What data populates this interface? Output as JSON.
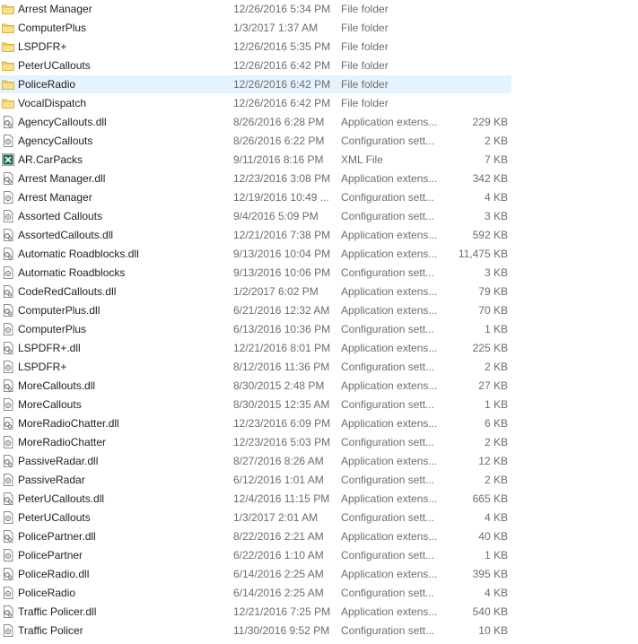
{
  "files": [
    {
      "name": "Arrest Manager",
      "date": "12/26/2016 5:34 PM",
      "type": "File folder",
      "size": "",
      "icon": "folder-icon"
    },
    {
      "name": "ComputerPlus",
      "date": "1/3/2017 1:37 AM",
      "type": "File folder",
      "size": "",
      "icon": "folder-icon"
    },
    {
      "name": "LSPDFR+",
      "date": "12/26/2016 5:35 PM",
      "type": "File folder",
      "size": "",
      "icon": "folder-icon"
    },
    {
      "name": "PeterUCallouts",
      "date": "12/26/2016 6:42 PM",
      "type": "File folder",
      "size": "",
      "icon": "folder-icon"
    },
    {
      "name": "PoliceRadio",
      "date": "12/26/2016 6:42 PM",
      "type": "File folder",
      "size": "",
      "icon": "folder-icon",
      "selected": true
    },
    {
      "name": "VocalDispatch",
      "date": "12/26/2016 6:42 PM",
      "type": "File folder",
      "size": "",
      "icon": "folder-icon"
    },
    {
      "name": "AgencyCallouts.dll",
      "date": "8/26/2016 6:28 PM",
      "type": "Application extens...",
      "size": "229 KB",
      "icon": "dll-icon"
    },
    {
      "name": "AgencyCallouts",
      "date": "8/26/2016 6:22 PM",
      "type": "Configuration sett...",
      "size": "2 KB",
      "icon": "config-icon"
    },
    {
      "name": "AR.CarPacks",
      "date": "9/11/2016 8:16 PM",
      "type": "XML File",
      "size": "7 KB",
      "icon": "xml-icon"
    },
    {
      "name": "Arrest Manager.dll",
      "date": "12/23/2016 3:08 PM",
      "type": "Application extens...",
      "size": "342 KB",
      "icon": "dll-icon"
    },
    {
      "name": "Arrest Manager",
      "date": "12/19/2016 10:49 ...",
      "type": "Configuration sett...",
      "size": "4 KB",
      "icon": "config-icon"
    },
    {
      "name": "Assorted Callouts",
      "date": "9/4/2016 5:09 PM",
      "type": "Configuration sett...",
      "size": "3 KB",
      "icon": "config-icon"
    },
    {
      "name": "AssortedCallouts.dll",
      "date": "12/21/2016 7:38 PM",
      "type": "Application extens...",
      "size": "592 KB",
      "icon": "dll-icon"
    },
    {
      "name": "Automatic Roadblocks.dll",
      "date": "9/13/2016 10:04 PM",
      "type": "Application extens...",
      "size": "11,475 KB",
      "icon": "dll-icon"
    },
    {
      "name": "Automatic Roadblocks",
      "date": "9/13/2016 10:06 PM",
      "type": "Configuration sett...",
      "size": "3 KB",
      "icon": "config-icon"
    },
    {
      "name": "CodeRedCallouts.dll",
      "date": "1/2/2017 6:02 PM",
      "type": "Application extens...",
      "size": "79 KB",
      "icon": "dll-icon"
    },
    {
      "name": "ComputerPlus.dll",
      "date": "6/21/2016 12:32 AM",
      "type": "Application extens...",
      "size": "70 KB",
      "icon": "dll-icon"
    },
    {
      "name": "ComputerPlus",
      "date": "6/13/2016 10:36 PM",
      "type": "Configuration sett...",
      "size": "1 KB",
      "icon": "config-icon"
    },
    {
      "name": "LSPDFR+.dll",
      "date": "12/21/2016 8:01 PM",
      "type": "Application extens...",
      "size": "225 KB",
      "icon": "dll-icon"
    },
    {
      "name": "LSPDFR+",
      "date": "8/12/2016 11:36 PM",
      "type": "Configuration sett...",
      "size": "2 KB",
      "icon": "config-icon"
    },
    {
      "name": "MoreCallouts.dll",
      "date": "8/30/2015 2:48 PM",
      "type": "Application extens...",
      "size": "27 KB",
      "icon": "dll-icon"
    },
    {
      "name": "MoreCallouts",
      "date": "8/30/2015 12:35 AM",
      "type": "Configuration sett...",
      "size": "1 KB",
      "icon": "config-icon"
    },
    {
      "name": "MoreRadioChatter.dll",
      "date": "12/23/2016 6:09 PM",
      "type": "Application extens...",
      "size": "6 KB",
      "icon": "dll-icon"
    },
    {
      "name": "MoreRadioChatter",
      "date": "12/23/2016 5:03 PM",
      "type": "Configuration sett...",
      "size": "2 KB",
      "icon": "config-icon"
    },
    {
      "name": "PassiveRadar.dll",
      "date": "8/27/2016 8:26 AM",
      "type": "Application extens...",
      "size": "12 KB",
      "icon": "dll-icon"
    },
    {
      "name": "PassiveRadar",
      "date": "6/12/2016 1:01 AM",
      "type": "Configuration sett...",
      "size": "2 KB",
      "icon": "config-icon"
    },
    {
      "name": "PeterUCallouts.dll",
      "date": "12/4/2016 11:15 PM",
      "type": "Application extens...",
      "size": "665 KB",
      "icon": "dll-icon"
    },
    {
      "name": "PeterUCallouts",
      "date": "1/3/2017 2:01 AM",
      "type": "Configuration sett...",
      "size": "4 KB",
      "icon": "config-icon"
    },
    {
      "name": "PolicePartner.dll",
      "date": "8/22/2016 2:21 AM",
      "type": "Application extens...",
      "size": "40 KB",
      "icon": "dll-icon"
    },
    {
      "name": "PolicePartner",
      "date": "6/22/2016 1:10 AM",
      "type": "Configuration sett...",
      "size": "1 KB",
      "icon": "config-icon"
    },
    {
      "name": "PoliceRadio.dll",
      "date": "6/14/2016 2:25 AM",
      "type": "Application extens...",
      "size": "395 KB",
      "icon": "dll-icon"
    },
    {
      "name": "PoliceRadio",
      "date": "6/14/2016 2:25 AM",
      "type": "Configuration sett...",
      "size": "4 KB",
      "icon": "config-icon"
    },
    {
      "name": "Traffic Policer.dll",
      "date": "12/21/2016 7:25 PM",
      "type": "Application extens...",
      "size": "540 KB",
      "icon": "dll-icon"
    },
    {
      "name": "Traffic Policer",
      "date": "11/30/2016 9:52 PM",
      "type": "Configuration sett...",
      "size": "10 KB",
      "icon": "config-icon"
    }
  ],
  "colors": {
    "selection": "#e5f3ff",
    "folder": "#f8d775",
    "text": "#1e1e1e",
    "meta": "#6d6d6d",
    "excel": "#1d6f42"
  }
}
